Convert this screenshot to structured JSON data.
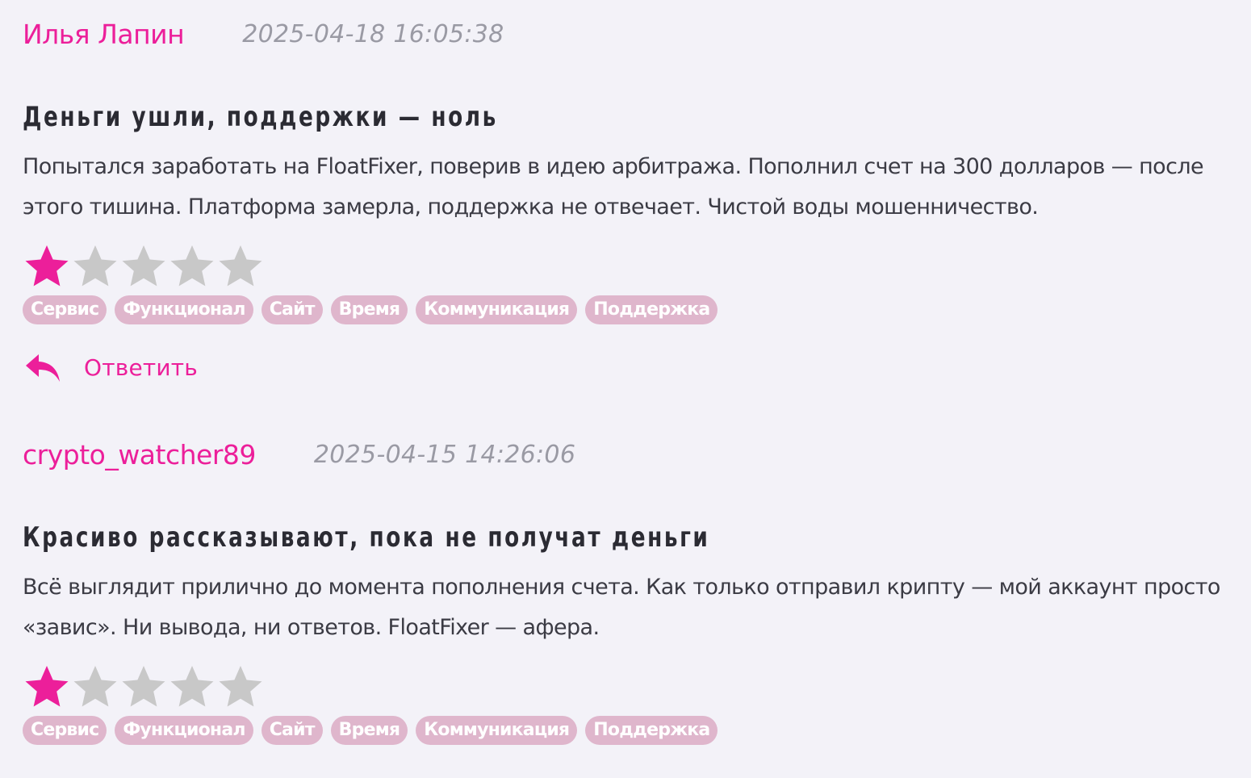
{
  "colors": {
    "accent": "#ec1f9a",
    "star_filled": "#ec1f9a",
    "star_empty": "#c8c8c8",
    "tag_bg": "#dfb6cc",
    "background": "#f3f2f8"
  },
  "reviews": [
    {
      "author": "Илья Лапин",
      "date": "2025-04-18 16:05:38",
      "title": "Деньги ушли, поддержки — ноль",
      "text": "Попытался заработать на FloatFixer, поверив в идею арбитража. Пополнил счет на 300 долларов — после этого тишина. Платформа замерла, поддержка не отвечает. Чистой воды мошенничество.",
      "rating": 1,
      "rating_max": 5,
      "tags": [
        "Сервис",
        "Функционал",
        "Сайт",
        "Время",
        "Коммуникация",
        "Поддержка"
      ],
      "reply_label": "Ответить",
      "reply_icon": "reply-arrow-icon"
    },
    {
      "author": "crypto_watcher89",
      "date": "2025-04-15 14:26:06",
      "title": "Красиво рассказывают, пока не получат деньги",
      "text": "Всё выглядит прилично до момента пополнения счета. Как только отправил крипту — мой аккаунт просто «завис». Ни вывода, ни ответов. FloatFixer — афера.",
      "rating": 1,
      "rating_max": 5,
      "tags": [
        "Сервис",
        "Функционал",
        "Сайт",
        "Время",
        "Коммуникация",
        "Поддержка"
      ]
    }
  ]
}
